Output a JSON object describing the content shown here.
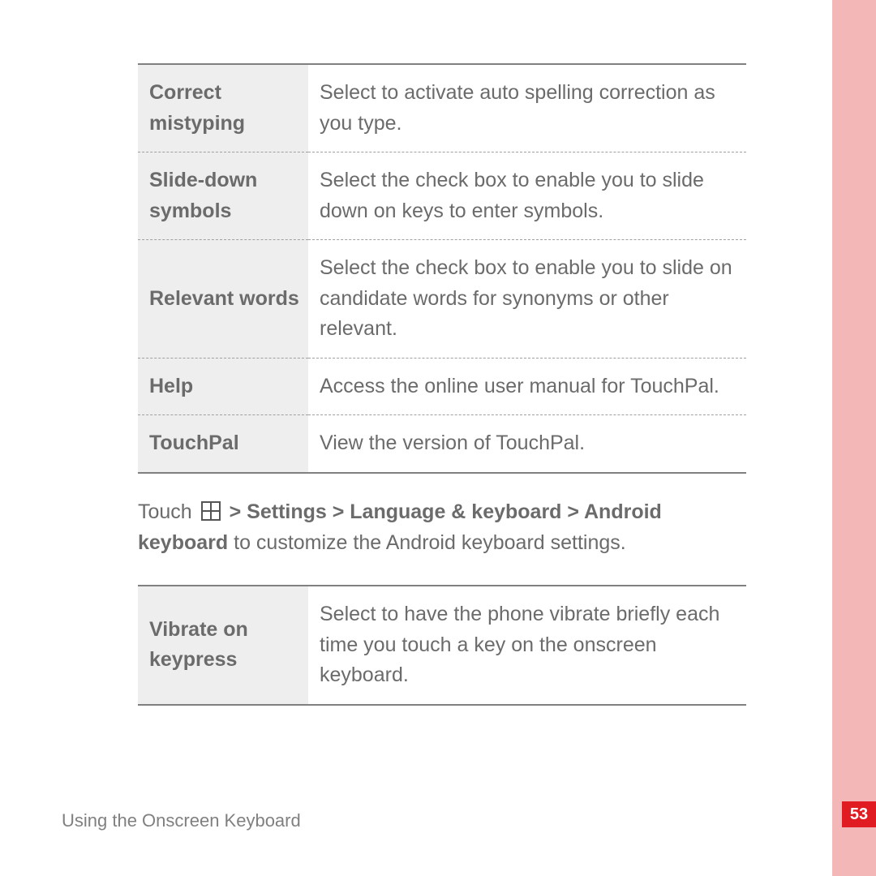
{
  "tableA": {
    "rows": [
      {
        "label": "Correct mistyping",
        "desc": "Select to activate auto spelling correction as you type."
      },
      {
        "label": "Slide-down symbols",
        "desc": "Select the check box to enable you to slide down on keys to enter symbols."
      },
      {
        "label": "Relevant words",
        "desc": "Select the check box to enable you to slide on candidate words for synonyms or other relevant."
      },
      {
        "label": "Help",
        "desc": "Access the online user manual for TouchPal."
      },
      {
        "label": "TouchPal",
        "desc": "View the version of TouchPal."
      }
    ]
  },
  "instruction": {
    "prefix": "Touch ",
    "path": " > Settings > Language & keyboard > Android keyboard",
    "suffix": " to customize the Android keyboard settings."
  },
  "tableB": {
    "rows": [
      {
        "label": "Vibrate on keypress",
        "desc": "Select to have the phone vibrate briefly each time you touch a key on the onscreen keyboard."
      }
    ]
  },
  "footer": "Using the Onscreen Keyboard",
  "pageNumber": "53"
}
